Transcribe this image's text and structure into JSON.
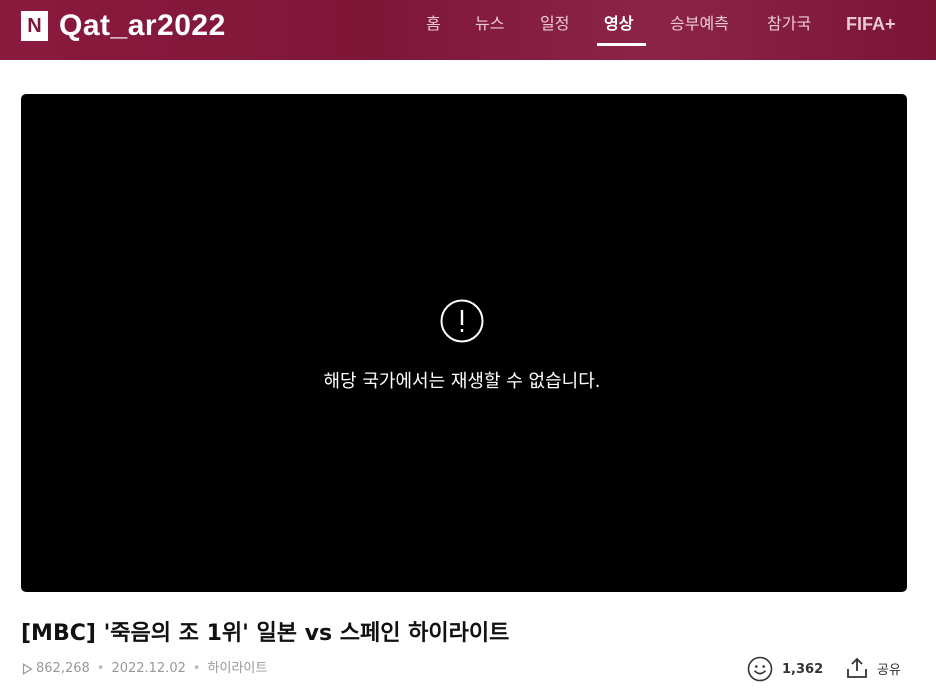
{
  "header": {
    "logo_n": "N",
    "logo_text": "Qat_ar2022",
    "nav": [
      "홈",
      "뉴스",
      "일정",
      "영상",
      "승부예측",
      "참가국"
    ],
    "active_nav": "영상",
    "fifa_label": "FIFA+"
  },
  "player": {
    "message": "해당 국가에서는 재생할 수 없습니다.",
    "icon": "exclamation-circle-icon"
  },
  "video": {
    "title": "[MBC] '죽음의 조 1위' 일본 vs 스페인 하이라이트",
    "views": "862,268",
    "date": "2022.12.02",
    "category": "하이라이트",
    "reactions": "1,362",
    "share_label": "공유"
  },
  "colors": {
    "header_bg": "#7e1638",
    "player_bg": "#000000",
    "meta_text": "#999999"
  }
}
